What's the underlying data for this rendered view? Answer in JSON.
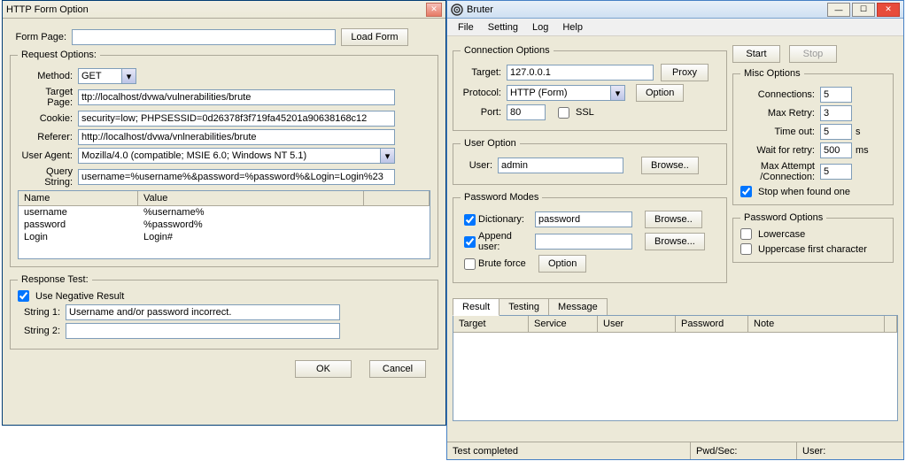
{
  "left": {
    "title": "HTTP Form Option",
    "formPage": {
      "label": "Form Page:",
      "value": "",
      "loadBtn": "Load Form"
    },
    "requestOptions": {
      "legend": "Request Options:",
      "method": {
        "label": "Method:",
        "value": "GET"
      },
      "targetPage": {
        "label": "Target Page:",
        "value": "ttp://localhost/dvwa/vulnerabilities/brute"
      },
      "cookie": {
        "label": "Cookie:",
        "value": "security=low; PHPSESSID=0d26378f3f719fa45201a90638168c12"
      },
      "referer": {
        "label": "Referer:",
        "value": "http://localhost/dvwa/vnlnerabilities/brute"
      },
      "userAgent": {
        "label": "User Agent:",
        "value": "Mozilla/4.0 (compatible; MSIE 6.0; Windows NT 5.1)"
      },
      "queryString": {
        "label": "Query String:",
        "value": "username=%username%&password=%password%&Login=Login%23"
      },
      "tableHeaders": {
        "name": "Name",
        "value": "Value"
      },
      "tableRows": [
        {
          "name": "username",
          "value": "%username%"
        },
        {
          "name": "password",
          "value": "%password%"
        },
        {
          "name": "Login",
          "value": "Login#"
        }
      ]
    },
    "responseTest": {
      "legend": "Response Test:",
      "useNegative": "Use Negative Result",
      "string1": {
        "label": "String 1:",
        "value": "Username and/or password incorrect."
      },
      "string2": {
        "label": "String 2:",
        "value": ""
      }
    },
    "buttons": {
      "ok": "OK",
      "cancel": "Cancel"
    }
  },
  "right": {
    "title": "Bruter",
    "menu": {
      "file": "File",
      "setting": "Setting",
      "log": "Log",
      "help": "Help"
    },
    "connection": {
      "legend": "Connection Options",
      "target": {
        "label": "Target:",
        "value": "127.0.0.1"
      },
      "proxy": "Proxy",
      "protocol": {
        "label": "Protocol:",
        "value": "HTTP (Form)"
      },
      "option": "Option",
      "port": {
        "label": "Port:",
        "value": "80"
      },
      "ssl": "SSL"
    },
    "userOption": {
      "legend": "User Option",
      "user": {
        "label": "User:",
        "value": "admin"
      },
      "browse": "Browse.."
    },
    "passwordModes": {
      "legend": "Password Modes",
      "dictionary": {
        "label": "Dictionary:",
        "value": "password"
      },
      "browse1": "Browse..",
      "appendUser": {
        "label": "Append user:",
        "value": ""
      },
      "browse2": "Browse...",
      "bruteForce": "Brute force",
      "option": "Option"
    },
    "btns": {
      "start": "Start",
      "stop": "Stop"
    },
    "misc": {
      "legend": "Misc Options",
      "connections": {
        "label": "Connections:",
        "value": "5"
      },
      "maxRetry": {
        "label": "Max Retry:",
        "value": "3"
      },
      "timeout": {
        "label": "Time out:",
        "value": "5",
        "unit": "s"
      },
      "waitRetry": {
        "label": "Wait for retry:",
        "value": "500",
        "unit": "ms"
      },
      "maxAttempt": {
        "label": "Max Attempt /Connection:",
        "value": "5"
      },
      "stopWhen": "Stop when found one"
    },
    "pwdOpt": {
      "legend": "Password Options",
      "lowercase": "Lowercase",
      "upperfirst": "Uppercase first character"
    },
    "tabs": {
      "result": "Result",
      "testing": "Testing",
      "message": "Message"
    },
    "grid": {
      "target": "Target",
      "service": "Service",
      "user": "User",
      "password": "Password",
      "note": "Note"
    },
    "status": {
      "left": "Test completed",
      "mid": "Pwd/Sec:",
      "right": "User:"
    }
  }
}
